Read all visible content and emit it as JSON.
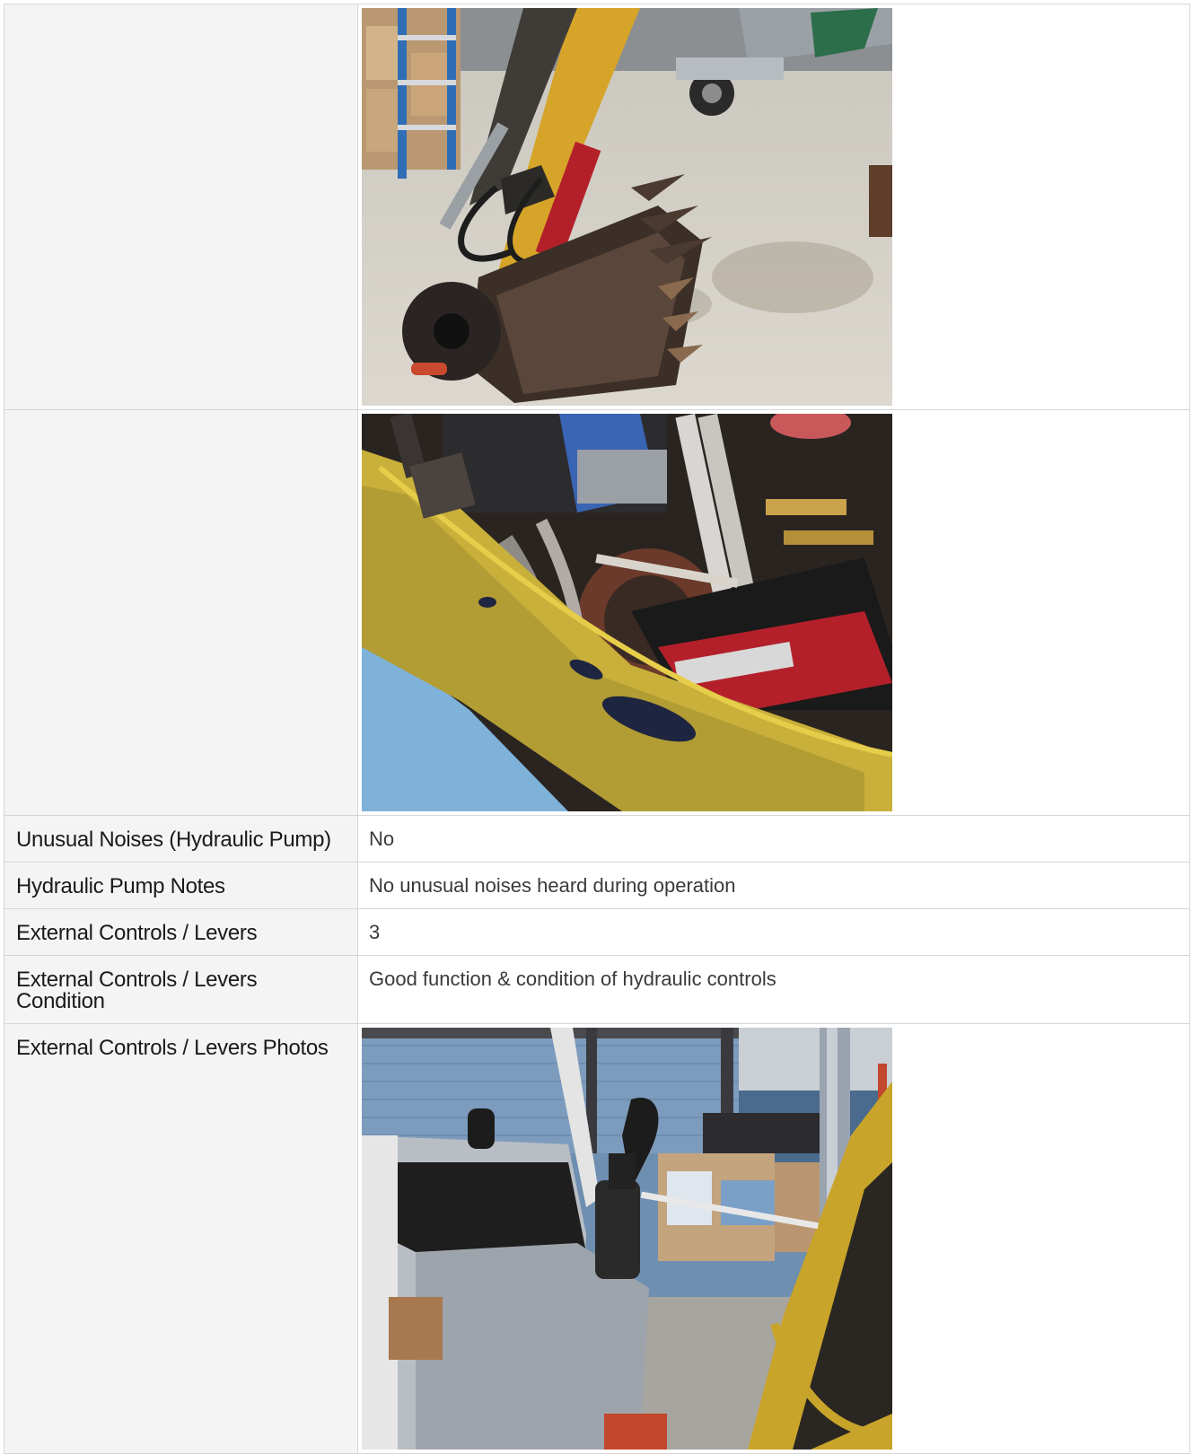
{
  "rows": [
    {
      "label": "",
      "type": "photo",
      "photo": "excavator-bucket-arm-photo"
    },
    {
      "label": "",
      "type": "photo",
      "photo": "boom-hydraulic-hoses-photo"
    },
    {
      "label": "Unusual Noises (Hydraulic Pump)",
      "value": "No"
    },
    {
      "label": "Hydraulic Pump Notes",
      "value": "No unusual noises heard during operation"
    },
    {
      "label": "External Controls / Levers",
      "value": "3"
    },
    {
      "label": "External Controls / Levers Condition",
      "value": "Good function & condition of hydraulic controls"
    },
    {
      "label": "External Controls / Levers Photos",
      "type": "photo",
      "photo": "operator-controls-joystick-photo"
    }
  ],
  "colors": {
    "label_bg": "#f4f4f4",
    "value_bg": "#ffffff",
    "border": "#d6d6d6",
    "label_text": "#1a1a1a",
    "value_text": "#3a3a3a"
  }
}
